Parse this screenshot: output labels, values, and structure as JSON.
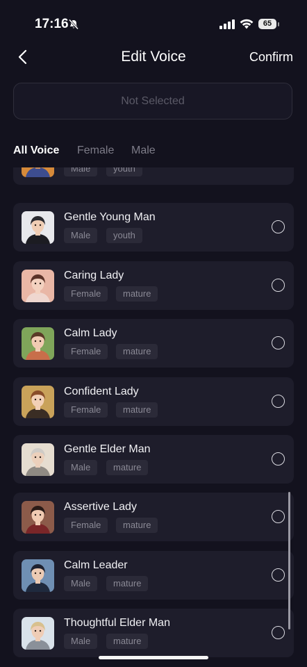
{
  "status": {
    "time": "17:16",
    "battery": "65"
  },
  "nav": {
    "title": "Edit Voice",
    "confirm": "Confirm"
  },
  "selection": {
    "placeholder": "Not Selected"
  },
  "tabs": [
    {
      "label": "All Voice",
      "active": true
    },
    {
      "label": "Female",
      "active": false
    },
    {
      "label": "Male",
      "active": false
    }
  ],
  "voices": [
    {
      "name": "",
      "tags": [
        "Male",
        "youth"
      ],
      "selected": false
    },
    {
      "name": "Gentle Young Man",
      "tags": [
        "Male",
        "youth"
      ],
      "selected": false
    },
    {
      "name": "Caring Lady",
      "tags": [
        "Female",
        "mature"
      ],
      "selected": false
    },
    {
      "name": "Calm Lady",
      "tags": [
        "Female",
        "mature"
      ],
      "selected": false
    },
    {
      "name": "Confident Lady",
      "tags": [
        "Female",
        "mature"
      ],
      "selected": false
    },
    {
      "name": "Gentle Elder Man",
      "tags": [
        "Male",
        "mature"
      ],
      "selected": false
    },
    {
      "name": "Assertive Lady",
      "tags": [
        "Female",
        "mature"
      ],
      "selected": false
    },
    {
      "name": "Calm Leader",
      "tags": [
        "Male",
        "mature"
      ],
      "selected": false
    },
    {
      "name": "Thoughtful Elder Man",
      "tags": [
        "Male",
        "mature"
      ],
      "selected": false
    }
  ],
  "colors": {
    "background": "#13121e",
    "card": "#1e1d2b",
    "tag_bg": "#2b2a38",
    "tag_text": "#8a8995",
    "accent_text": "#ffffff"
  }
}
